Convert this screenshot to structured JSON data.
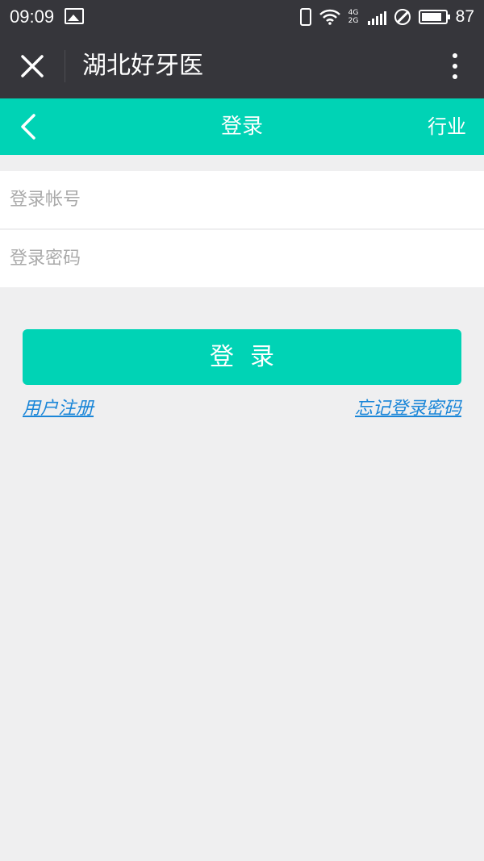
{
  "status_bar": {
    "time": "09:09",
    "network_top": "4G",
    "network_bottom": "2G",
    "battery_level": "87",
    "battery_fraction": 0.87
  },
  "app_bar": {
    "title": "湖北好牙医",
    "close_icon": "close-icon",
    "more_icon": "more-vertical-icon"
  },
  "header": {
    "title": "登录",
    "right_link": "行业",
    "back_icon": "chevron-left-icon"
  },
  "form": {
    "account_placeholder": "登录帐号",
    "account_value": "",
    "password_placeholder": "登录密码",
    "password_value": "",
    "submit_label": "登录"
  },
  "links": {
    "register": "用户注册",
    "forgot_password": "忘记登录密码"
  },
  "colors": {
    "accent": "#00d3b5",
    "dark_bar": "#36363b",
    "background": "#efeff0",
    "link": "#1a86d8"
  }
}
